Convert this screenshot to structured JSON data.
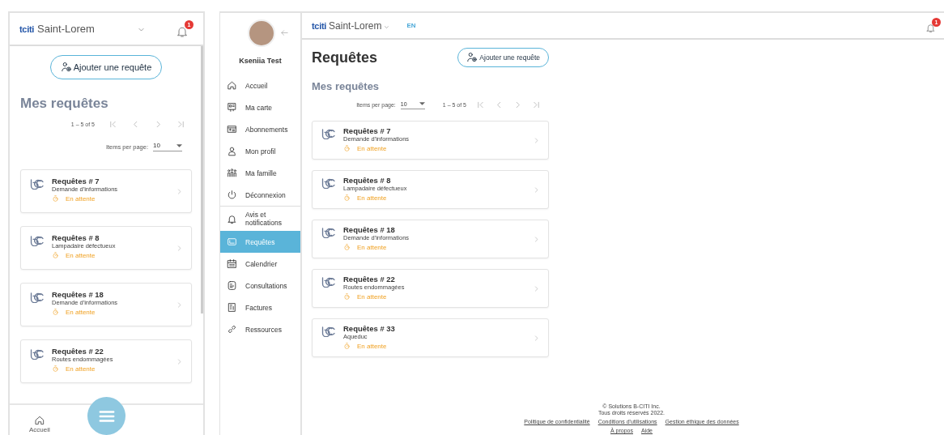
{
  "mobile": {
    "header": {
      "brand": "tciti",
      "city": "Saint-Lorem",
      "notification_count": "1"
    },
    "add_button": "Ajouter une requête",
    "heading": "Mes requêtes",
    "range": "1 – 5 of 5",
    "items_per_page_label": "Items per page:",
    "items_per_page": "10",
    "requests": [
      {
        "title": "Requêtes # 7",
        "subtitle": "Demande d'informations",
        "status": "En attente"
      },
      {
        "title": "Requêtes # 8",
        "subtitle": "Lampadaire défectueux",
        "status": "En attente"
      },
      {
        "title": "Requêtes # 18",
        "subtitle": "Demande d'informations",
        "status": "En attente"
      },
      {
        "title": "Requêtes # 22",
        "subtitle": "Routes endommagées",
        "status": "En attente"
      }
    ],
    "bottom_nav": {
      "label": "Accueil"
    }
  },
  "desktop": {
    "sidebar": {
      "user_name": "Kseniia Test",
      "items": [
        {
          "label": "Accueil",
          "selected": false
        },
        {
          "label": "Ma carte",
          "selected": false
        },
        {
          "label": "Abonnements",
          "selected": false
        },
        {
          "label": "Mon profil",
          "selected": false
        },
        {
          "label": "Ma famille",
          "selected": false
        },
        {
          "label": "Déconnexion",
          "selected": false
        },
        {
          "label": "Avis et notifications",
          "selected": false
        },
        {
          "label": "Requêtes",
          "selected": true
        },
        {
          "label": "Calendrier",
          "selected": false
        },
        {
          "label": "Consultations",
          "selected": false
        },
        {
          "label": "Factures",
          "selected": false
        },
        {
          "label": "Ressources",
          "selected": false
        }
      ]
    },
    "topbar": {
      "brand": "tciti",
      "city": "Saint-Lorem",
      "language": "EN",
      "notification_count": "1"
    },
    "title": "Requêtes",
    "add_button": "Ajouter une requête",
    "heading": "Mes requêtes",
    "items_per_page_label": "Items per page:",
    "items_per_page": "10",
    "range": "1 – 5 of 5",
    "requests": [
      {
        "title": "Requêtes # 7",
        "subtitle": "Demande d'informations",
        "status": "En attente"
      },
      {
        "title": "Requêtes # 8",
        "subtitle": "Lampadaire défectueux",
        "status": "En attente"
      },
      {
        "title": "Requêtes # 18",
        "subtitle": "Demande d'informations",
        "status": "En attente"
      },
      {
        "title": "Requêtes # 22",
        "subtitle": "Routes endommagées",
        "status": "En attente"
      },
      {
        "title": "Requêtes # 33",
        "subtitle": "Aqueduc",
        "status": "En attente"
      }
    ],
    "footer": {
      "copyright": [
        "© Solutions B-CITI Inc.",
        "Tous droits réservés 2022."
      ],
      "links": [
        "Politique de confidentialité",
        "Conditions d'utilisations",
        "Gestion éthique des données",
        "À propos",
        "Aide"
      ]
    }
  }
}
